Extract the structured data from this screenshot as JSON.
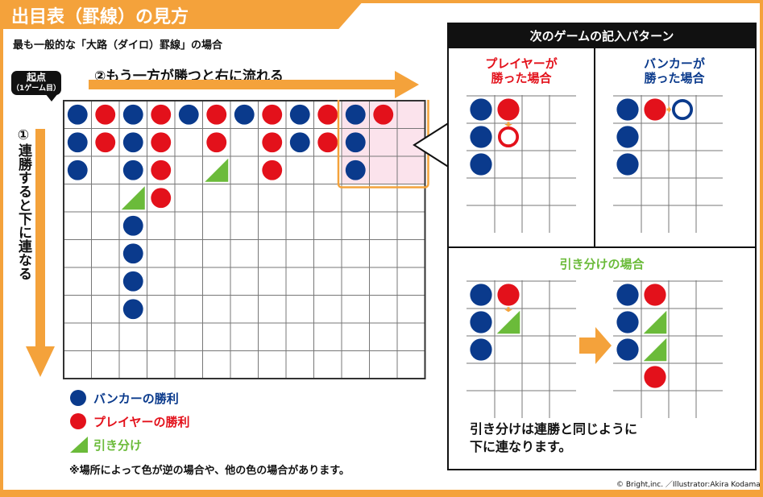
{
  "title": "出目表（罫線）の見方",
  "subtitle": "最も一般的な「大路（ダイロ）罫線」の場合",
  "start_badge": {
    "line1": "起点",
    "line2": "（1ゲーム目）"
  },
  "horizontal_arrow_label": "②もう一方が勝つと右に流れる",
  "vertical_arrow_label": "①連勝すると下に連なる",
  "legend": [
    {
      "label": "バンカーの勝利",
      "color": "#0a3a8c",
      "icon": "blue-circle-icon"
    },
    {
      "label": "プレイヤーの勝利",
      "color": "#e3111b",
      "icon": "red-circle-icon"
    },
    {
      "label": "引き分け",
      "color": "#6bbb3a",
      "icon": "green-triangle-icon"
    }
  ],
  "note": "※場所によって色が逆の場合や、他の色の場合があります。",
  "pattern_panel": {
    "header": "次のゲームの記入パターン",
    "player_case_title": "プレイヤーが\n勝った場合",
    "banker_case_title": "バンカーが\n勝った場合",
    "tie_case_title": "引き分けの場合",
    "tie_note_line1": "引き分けは連勝と同じように",
    "tie_note_line2": "下に連なります。"
  },
  "credit": "© Bright,inc. ／Illustrator:Akira Kodama",
  "colors": {
    "banker": "#0a3a8c",
    "player": "#e3111b",
    "tie": "#6bbb3a",
    "accent": "#f4a23b",
    "highlight": "#fbe3ec"
  },
  "main_grid": {
    "cols": 13,
    "rows": 10,
    "marks": [
      {
        "c": 0,
        "r": 0,
        "t": "B"
      },
      {
        "c": 0,
        "r": 1,
        "t": "B"
      },
      {
        "c": 0,
        "r": 2,
        "t": "B"
      },
      {
        "c": 1,
        "r": 0,
        "t": "P"
      },
      {
        "c": 1,
        "r": 1,
        "t": "P"
      },
      {
        "c": 2,
        "r": 0,
        "t": "B"
      },
      {
        "c": 2,
        "r": 1,
        "t": "B"
      },
      {
        "c": 2,
        "r": 2,
        "t": "B"
      },
      {
        "c": 2,
        "r": 3,
        "t": "T"
      },
      {
        "c": 2,
        "r": 4,
        "t": "B"
      },
      {
        "c": 2,
        "r": 5,
        "t": "B"
      },
      {
        "c": 2,
        "r": 6,
        "t": "B"
      },
      {
        "c": 2,
        "r": 7,
        "t": "B"
      },
      {
        "c": 3,
        "r": 0,
        "t": "P"
      },
      {
        "c": 3,
        "r": 1,
        "t": "P"
      },
      {
        "c": 3,
        "r": 2,
        "t": "P"
      },
      {
        "c": 3,
        "r": 3,
        "t": "P"
      },
      {
        "c": 4,
        "r": 0,
        "t": "B"
      },
      {
        "c": 5,
        "r": 0,
        "t": "P"
      },
      {
        "c": 5,
        "r": 1,
        "t": "P"
      },
      {
        "c": 5,
        "r": 2,
        "t": "T"
      },
      {
        "c": 6,
        "r": 0,
        "t": "B"
      },
      {
        "c": 7,
        "r": 0,
        "t": "P"
      },
      {
        "c": 7,
        "r": 1,
        "t": "P"
      },
      {
        "c": 7,
        "r": 2,
        "t": "P"
      },
      {
        "c": 8,
        "r": 0,
        "t": "B"
      },
      {
        "c": 8,
        "r": 1,
        "t": "B"
      },
      {
        "c": 9,
        "r": 0,
        "t": "P"
      },
      {
        "c": 9,
        "r": 1,
        "t": "P"
      },
      {
        "c": 10,
        "r": 0,
        "t": "B"
      },
      {
        "c": 10,
        "r": 1,
        "t": "B"
      },
      {
        "c": 10,
        "r": 2,
        "t": "B"
      },
      {
        "c": 11,
        "r": 0,
        "t": "P"
      }
    ]
  },
  "player_case": {
    "cols": 4,
    "rows": 5,
    "marks": [
      {
        "c": 0,
        "r": 0,
        "t": "B"
      },
      {
        "c": 0,
        "r": 1,
        "t": "B"
      },
      {
        "c": 0,
        "r": 2,
        "t": "B"
      },
      {
        "c": 1,
        "r": 0,
        "t": "P"
      },
      {
        "c": 1,
        "r": 1,
        "t": "P_next"
      }
    ]
  },
  "banker_case": {
    "cols": 4,
    "rows": 5,
    "marks": [
      {
        "c": 0,
        "r": 0,
        "t": "B"
      },
      {
        "c": 0,
        "r": 1,
        "t": "B"
      },
      {
        "c": 0,
        "r": 2,
        "t": "B"
      },
      {
        "c": 1,
        "r": 0,
        "t": "P"
      },
      {
        "c": 2,
        "r": 0,
        "t": "B_next"
      }
    ]
  },
  "tie_before": {
    "cols": 4,
    "rows": 5,
    "marks": [
      {
        "c": 0,
        "r": 0,
        "t": "B"
      },
      {
        "c": 0,
        "r": 1,
        "t": "B"
      },
      {
        "c": 0,
        "r": 2,
        "t": "B"
      },
      {
        "c": 1,
        "r": 0,
        "t": "P"
      },
      {
        "c": 1,
        "r": 1,
        "t": "T"
      }
    ]
  },
  "tie_after": {
    "cols": 4,
    "rows": 5,
    "marks": [
      {
        "c": 0,
        "r": 0,
        "t": "B"
      },
      {
        "c": 0,
        "r": 1,
        "t": "B"
      },
      {
        "c": 0,
        "r": 2,
        "t": "B"
      },
      {
        "c": 1,
        "r": 0,
        "t": "P"
      },
      {
        "c": 1,
        "r": 1,
        "t": "T"
      },
      {
        "c": 1,
        "r": 2,
        "t": "T"
      },
      {
        "c": 1,
        "r": 3,
        "t": "P"
      }
    ]
  }
}
